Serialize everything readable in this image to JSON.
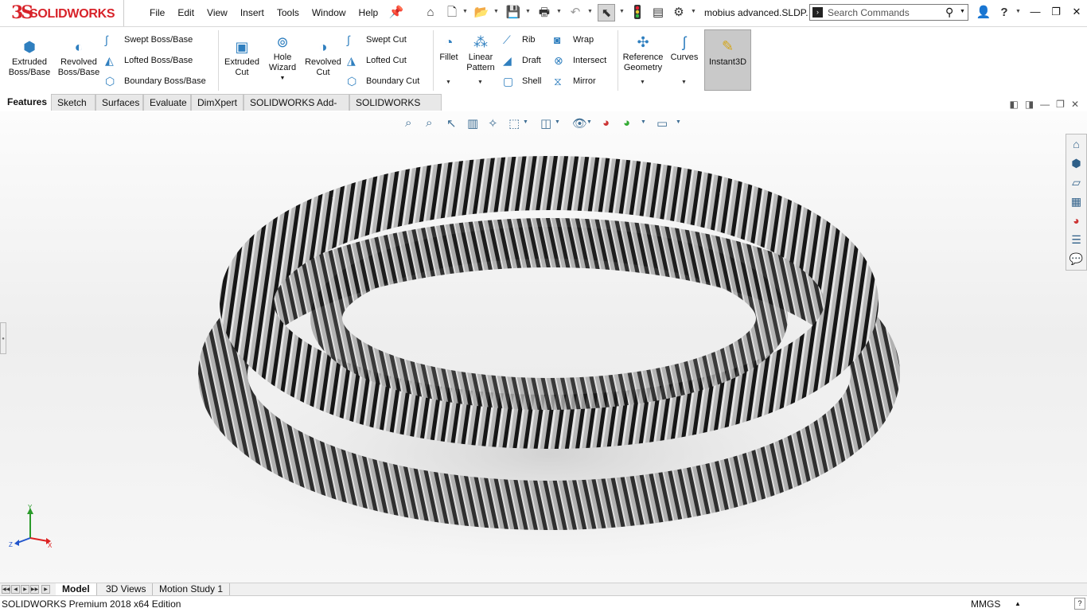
{
  "app": {
    "brand_mark": "3S",
    "brand_name": "SOLIDWORKS",
    "document_title": "mobius advanced.SLDP...",
    "status_text": "SOLIDWORKS Premium 2018 x64 Edition",
    "units": "MMGS"
  },
  "menu": [
    "File",
    "Edit",
    "View",
    "Insert",
    "Tools",
    "Window",
    "Help"
  ],
  "search": {
    "placeholder": "Search Commands"
  },
  "ribbon": {
    "extruded_boss": "Extruded Boss/Base",
    "revolved_boss": "Revolved Boss/Base",
    "swept_boss": "Swept Boss/Base",
    "lofted_boss": "Lofted Boss/Base",
    "boundary_boss": "Boundary Boss/Base",
    "extruded_cut": "Extruded Cut",
    "hole_wizard": "Hole Wizard",
    "revolved_cut": "Revolved Cut",
    "swept_cut": "Swept Cut",
    "lofted_cut": "Lofted Cut",
    "boundary_cut": "Boundary Cut",
    "fillet": "Fillet",
    "linear_pattern": "Linear Pattern",
    "rib": "Rib",
    "draft": "Draft",
    "shell": "Shell",
    "wrap": "Wrap",
    "intersect": "Intersect",
    "mirror": "Mirror",
    "reference_geometry": "Reference Geometry",
    "curves": "Curves",
    "instant3d": "Instant3D"
  },
  "command_tabs": [
    "Features",
    "Sketch",
    "Surfaces",
    "Evaluate",
    "DimXpert",
    "SOLIDWORKS Add-Ins",
    "SOLIDWORKS MBD"
  ],
  "bottom_tabs": [
    "Model",
    "3D Views",
    "Motion Study 1"
  ],
  "triad": {
    "y": "Y",
    "x": "X",
    "z": "Z"
  },
  "icons": {
    "home": "⌂",
    "new": "🗋",
    "open": "📂",
    "save": "💾",
    "print": "🖶",
    "undo": "↶",
    "select": "⬉",
    "options": "⚙",
    "user": "👤",
    "help": "?",
    "pin": "📌",
    "search": "⚲",
    "minimize": "—",
    "restore": "❐",
    "close": "✕"
  },
  "colors": {
    "brand": "#d8232a",
    "accent": "#2f7fbf"
  }
}
